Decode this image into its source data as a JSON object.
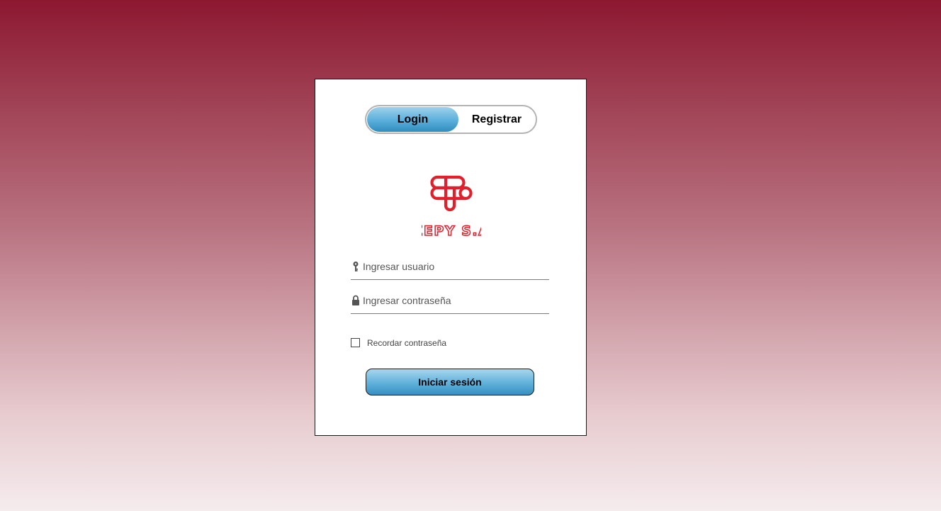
{
  "tabs": {
    "login": "Login",
    "register": "Registrar",
    "active": "login"
  },
  "brand": {
    "name": "ZEPY S.A",
    "color": "#e0202c"
  },
  "form": {
    "username": {
      "placeholder": "Ingresar usuario",
      "value": "",
      "icon": "key-icon"
    },
    "password": {
      "placeholder": "Ingresar contraseña",
      "value": "",
      "icon": "lock-icon"
    },
    "remember_label": "Recordar contraseña",
    "remember_checked": false,
    "submit_label": "Iniciar sesión"
  },
  "colors": {
    "background_top": "#8c1830",
    "background_bottom": "#f5ecee",
    "accent": "#5fb2dd"
  }
}
